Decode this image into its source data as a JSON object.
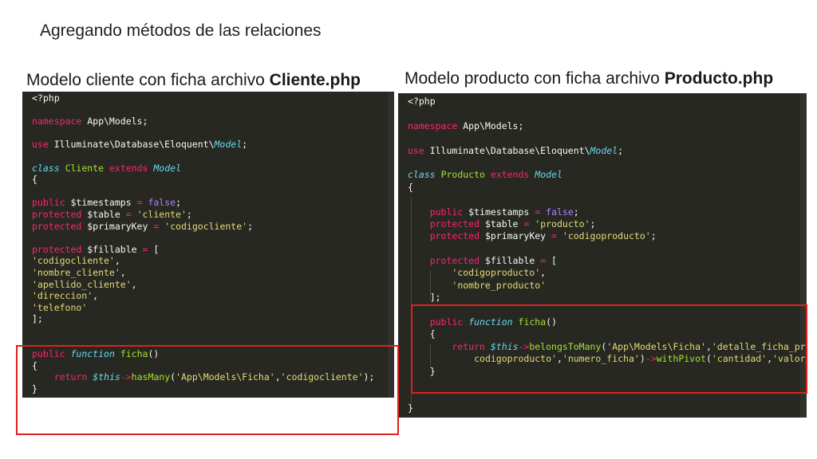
{
  "slide": {
    "title": "Agregando métodos de las relaciones"
  },
  "left": {
    "caption_prefix": "Modelo cliente con ficha  archivo ",
    "caption_file": "Cliente.php"
  },
  "right": {
    "caption_prefix": "Modelo producto con ficha archivo ",
    "caption_file": "Producto.php"
  },
  "colors": {
    "editor_bg": "#272822",
    "keyword": "#f92672",
    "string": "#e6db74",
    "function": "#a6e22e",
    "constant": "#ae81ff",
    "type": "#66d9ef",
    "highlight_box": "#e0201e"
  },
  "left_code": [
    [
      [
        "p",
        "<?php"
      ]
    ],
    [],
    [
      [
        "k",
        "namespace"
      ],
      [
        "p",
        " App\\Models;"
      ]
    ],
    [],
    [
      [
        "k",
        "use"
      ],
      [
        "p",
        " Illuminate\\Database\\Eloquent\\"
      ],
      [
        "t",
        "Model"
      ],
      [
        "p",
        ";"
      ]
    ],
    [],
    [
      [
        "t",
        "class"
      ],
      [
        "p",
        " "
      ],
      [
        "m",
        "Cliente"
      ],
      [
        "p",
        " "
      ],
      [
        "k",
        "extends"
      ],
      [
        "p",
        " "
      ],
      [
        "t",
        "Model"
      ]
    ],
    [
      [
        "p",
        "{"
      ]
    ],
    [],
    [
      [
        "k",
        "public"
      ],
      [
        "p",
        " $timestamps "
      ],
      [
        "k",
        "="
      ],
      [
        "p",
        " "
      ],
      [
        "n",
        "false"
      ],
      [
        "p",
        ";"
      ]
    ],
    [
      [
        "k",
        "protected"
      ],
      [
        "p",
        " $table "
      ],
      [
        "k",
        "="
      ],
      [
        "p",
        " "
      ],
      [
        "s",
        "'cliente'"
      ],
      [
        "p",
        ";"
      ]
    ],
    [
      [
        "k",
        "protected"
      ],
      [
        "p",
        " $primaryKey "
      ],
      [
        "k",
        "="
      ],
      [
        "p",
        " "
      ],
      [
        "s",
        "'codigocliente'"
      ],
      [
        "p",
        ";"
      ]
    ],
    [],
    [
      [
        "k",
        "protected"
      ],
      [
        "p",
        " $fillable "
      ],
      [
        "k",
        "="
      ],
      [
        "p",
        " ["
      ]
    ],
    [
      [
        "s",
        "'codigocliente'"
      ],
      [
        "p",
        ","
      ]
    ],
    [
      [
        "s",
        "'nombre_cliente'"
      ],
      [
        "p",
        ","
      ]
    ],
    [
      [
        "s",
        "'apellido_cliente'"
      ],
      [
        "p",
        ","
      ]
    ],
    [
      [
        "s",
        "'direccion'"
      ],
      [
        "p",
        ","
      ]
    ],
    [
      [
        "s",
        "'telefono'"
      ]
    ],
    [
      [
        "p",
        "];"
      ]
    ],
    [],
    [],
    [
      [
        "k",
        "public"
      ],
      [
        "p",
        " "
      ],
      [
        "t",
        "function"
      ],
      [
        "p",
        " "
      ],
      [
        "m",
        "ficha"
      ],
      [
        "p",
        "()"
      ]
    ],
    [
      [
        "p",
        "{"
      ]
    ],
    [
      [
        "p",
        "    "
      ],
      [
        "k",
        "return"
      ],
      [
        "p",
        " "
      ],
      [
        "t",
        "$this"
      ],
      [
        "k",
        "->"
      ],
      [
        "m",
        "hasMany"
      ],
      [
        "p",
        "("
      ],
      [
        "s",
        "'App\\Models\\Ficha'"
      ],
      [
        "p",
        ","
      ],
      [
        "s",
        "'codigocliente'"
      ],
      [
        "p",
        ");"
      ]
    ],
    [
      [
        "p",
        "}"
      ]
    ]
  ],
  "right_code": [
    [
      [
        "p",
        "<?php"
      ]
    ],
    [],
    [
      [
        "k",
        "namespace"
      ],
      [
        "p",
        " App\\Models;"
      ]
    ],
    [],
    [
      [
        "k",
        "use"
      ],
      [
        "p",
        " Illuminate\\Database\\Eloquent\\"
      ],
      [
        "t",
        "Model"
      ],
      [
        "p",
        ";"
      ]
    ],
    [],
    [
      [
        "t",
        "class"
      ],
      [
        "p",
        " "
      ],
      [
        "m",
        "Producto"
      ],
      [
        "p",
        " "
      ],
      [
        "k",
        "extends"
      ],
      [
        "p",
        " "
      ],
      [
        "t",
        "Model"
      ]
    ],
    [
      [
        "p",
        "{"
      ]
    ],
    [],
    [
      [
        "p",
        "    "
      ],
      [
        "k",
        "public"
      ],
      [
        "p",
        " $timestamps "
      ],
      [
        "k",
        "="
      ],
      [
        "p",
        " "
      ],
      [
        "n",
        "false"
      ],
      [
        "p",
        ";"
      ]
    ],
    [
      [
        "p",
        "    "
      ],
      [
        "k",
        "protected"
      ],
      [
        "p",
        " $table "
      ],
      [
        "k",
        "="
      ],
      [
        "p",
        " "
      ],
      [
        "s",
        "'producto'"
      ],
      [
        "p",
        ";"
      ]
    ],
    [
      [
        "p",
        "    "
      ],
      [
        "k",
        "protected"
      ],
      [
        "p",
        " $primaryKey "
      ],
      [
        "k",
        "="
      ],
      [
        "p",
        " "
      ],
      [
        "s",
        "'codigoproducto'"
      ],
      [
        "p",
        ";"
      ]
    ],
    [],
    [
      [
        "p",
        "    "
      ],
      [
        "k",
        "protected"
      ],
      [
        "p",
        " $fillable "
      ],
      [
        "k",
        "="
      ],
      [
        "p",
        " ["
      ]
    ],
    [
      [
        "p",
        "        "
      ],
      [
        "s",
        "'codigoproducto'"
      ],
      [
        "p",
        ","
      ]
    ],
    [
      [
        "p",
        "        "
      ],
      [
        "s",
        "'nombre_producto'"
      ]
    ],
    [
      [
        "p",
        "    ];"
      ]
    ],
    [],
    [
      [
        "p",
        "    "
      ],
      [
        "k",
        "public"
      ],
      [
        "p",
        " "
      ],
      [
        "t",
        "function"
      ],
      [
        "p",
        " "
      ],
      [
        "m",
        "ficha"
      ],
      [
        "p",
        "()"
      ]
    ],
    [
      [
        "p",
        "    {"
      ]
    ],
    [
      [
        "p",
        "        "
      ],
      [
        "k",
        "return"
      ],
      [
        "p",
        " "
      ],
      [
        "t",
        "$this"
      ],
      [
        "k",
        "->"
      ],
      [
        "m",
        "belongsToMany"
      ],
      [
        "p",
        "("
      ],
      [
        "s",
        "'App\\Models\\Ficha'"
      ],
      [
        "p",
        ","
      ],
      [
        "s",
        "'detalle_ficha_producto'"
      ],
      [
        "p",
        ","
      ],
      [
        "s",
        "'"
      ]
    ],
    [
      [
        "p",
        "            "
      ],
      [
        "s",
        "codigoproducto'"
      ],
      [
        "p",
        ","
      ],
      [
        "s",
        "'numero_ficha'"
      ],
      [
        "p",
        ")"
      ],
      [
        "k",
        "->"
      ],
      [
        "m",
        "withPivot"
      ],
      [
        "p",
        "("
      ],
      [
        "s",
        "'cantidad'"
      ],
      [
        "p",
        ","
      ],
      [
        "s",
        "'valor_unitario'"
      ],
      [
        "p",
        ");"
      ]
    ],
    [
      [
        "p",
        "    }"
      ]
    ],
    [],
    [],
    [
      [
        "p",
        "}"
      ]
    ]
  ]
}
